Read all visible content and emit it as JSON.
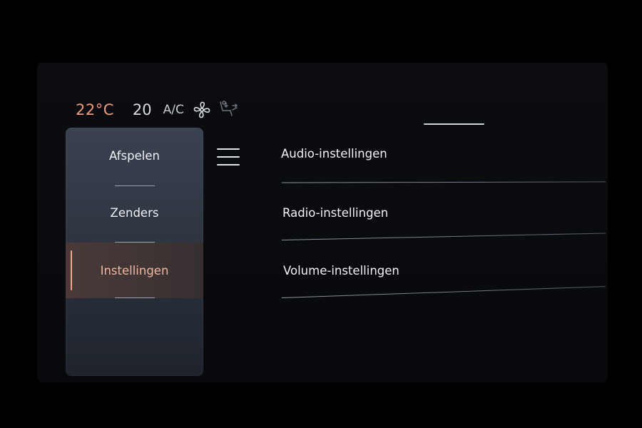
{
  "climate": {
    "temperature": "22°C",
    "fan_level": "20",
    "ac_label": "A/C",
    "fan_icon": "fan-icon",
    "seat_icon": "seat-airflow-icon",
    "accent_color": "#ee9a80"
  },
  "side_menu": {
    "items": [
      {
        "label": "Afspelen"
      },
      {
        "label": "Zenders"
      },
      {
        "label": "Instellingen",
        "active": true
      }
    ]
  },
  "menu_button_icon": "hamburger-menu-icon",
  "settings": {
    "rows": [
      {
        "label": "Audio-instellingen"
      },
      {
        "label": "Radio-instellingen"
      },
      {
        "label": "Volume-instellingen"
      }
    ]
  }
}
